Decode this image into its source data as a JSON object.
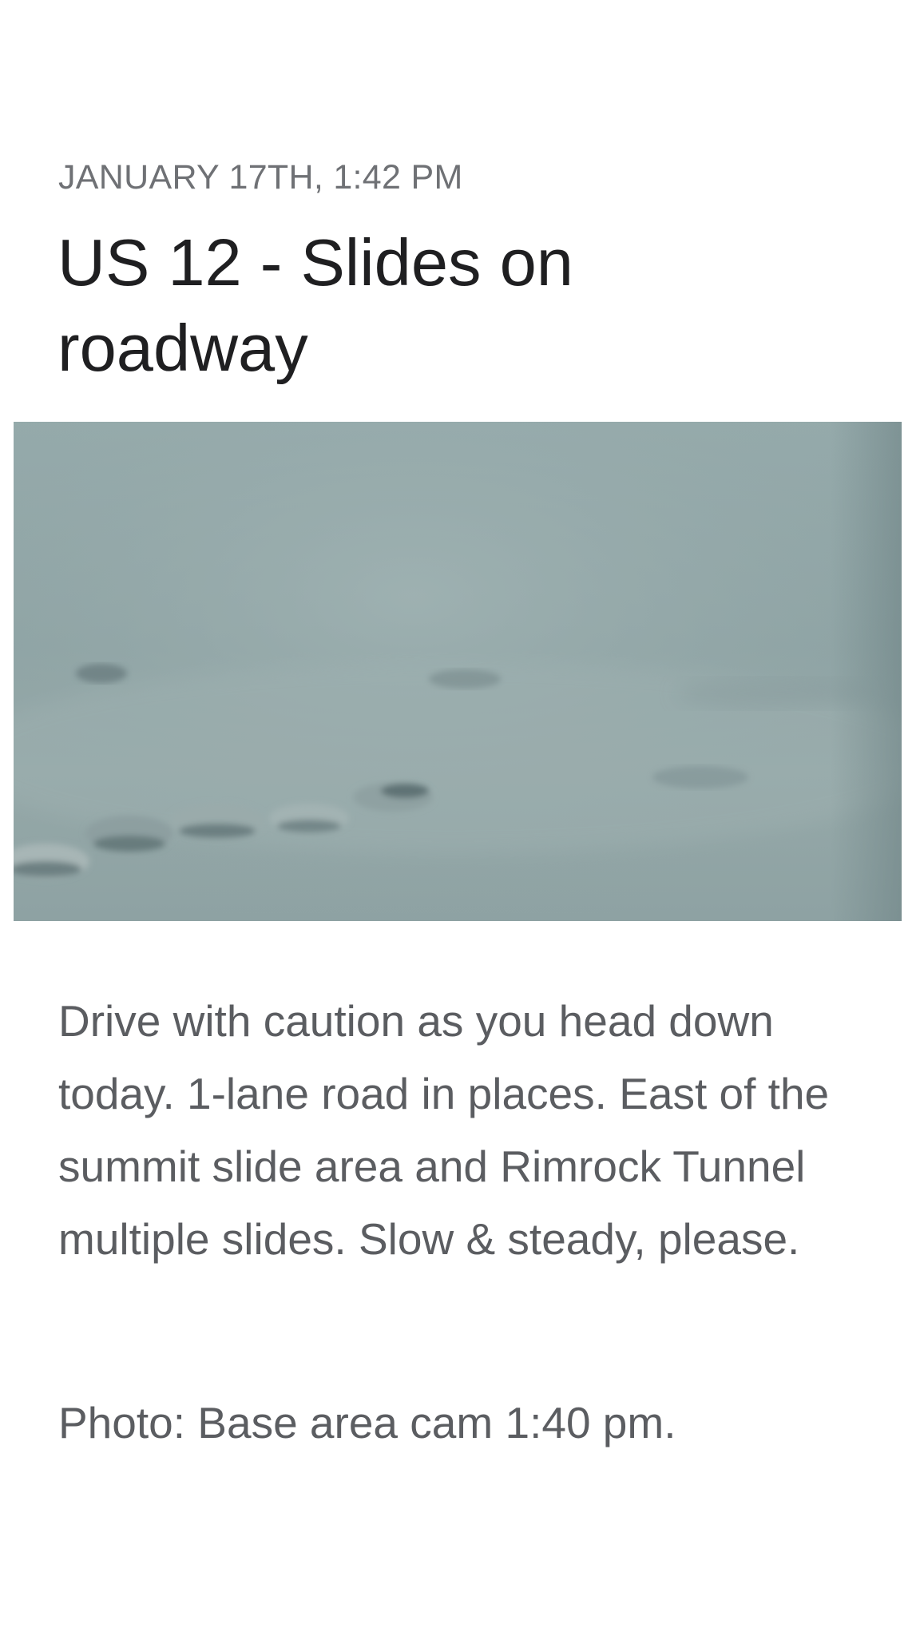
{
  "post": {
    "date": "JANUARY 17TH, 1:42 PM",
    "title": "US 12 - Slides on roadway",
    "photo": {
      "icon": "snowy-roadway-photo",
      "tint": "#8fa3a4"
    },
    "body": "Drive with caution as you head down today. 1-lane road in places. East of the summit slide area and Rimrock Tunnel multiple slides. Slow & steady, please.",
    "caption": "Photo: Base area cam 1:40 pm."
  },
  "colors": {
    "background": "#ffffff",
    "date_text": "#6f7175",
    "title_text": "#1f1f21",
    "body_text": "#5b5d61"
  }
}
